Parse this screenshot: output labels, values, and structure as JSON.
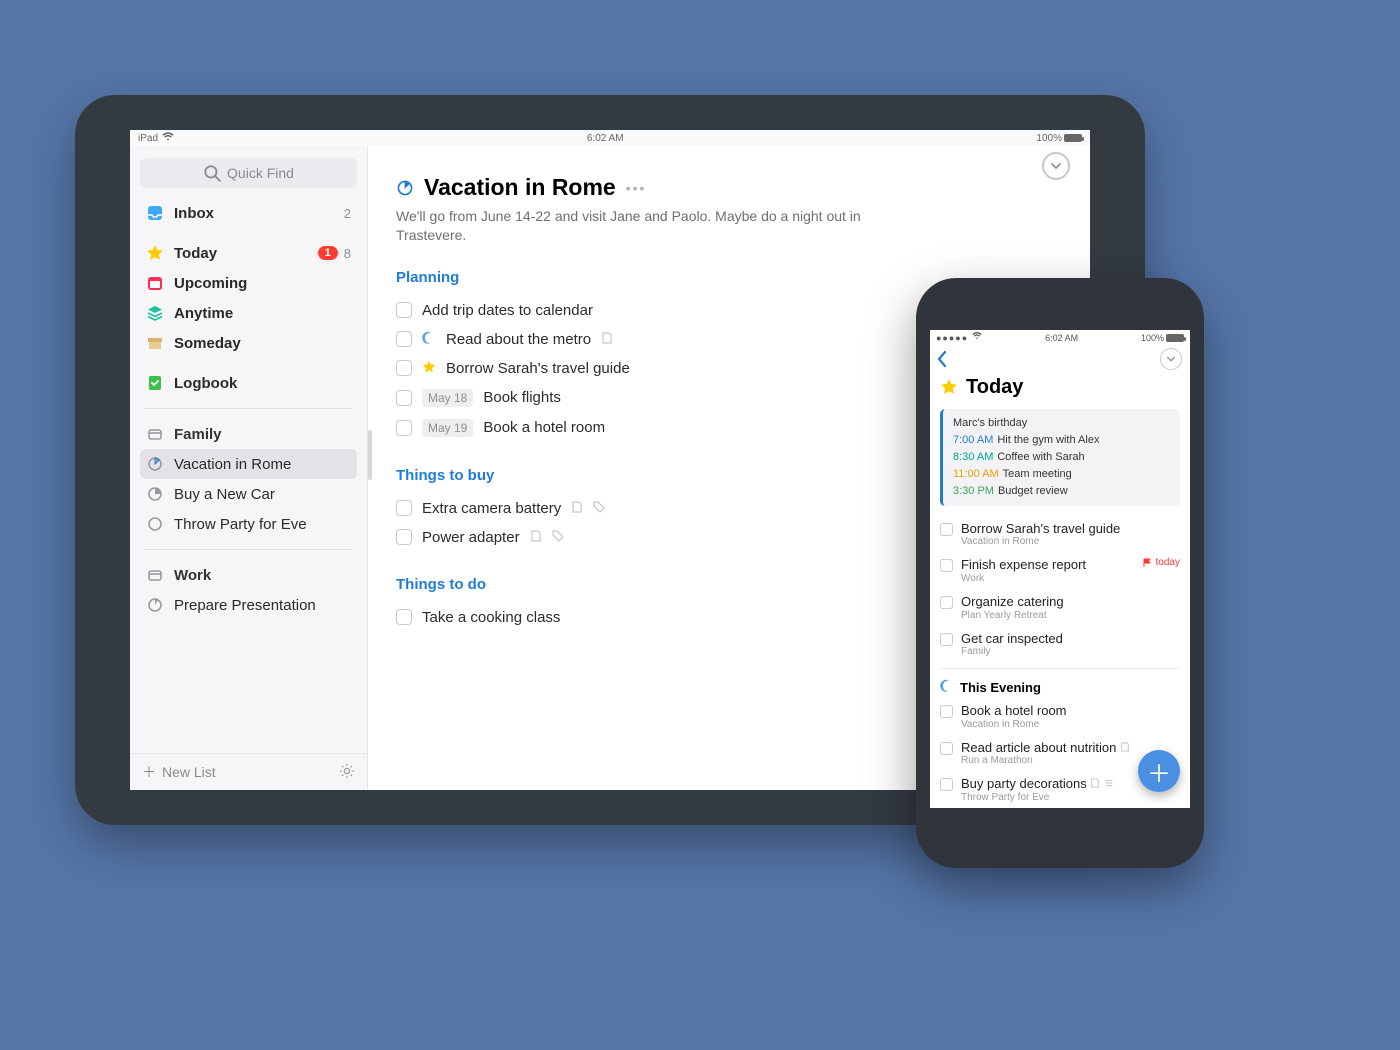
{
  "ipad": {
    "status": {
      "device": "iPad",
      "time": "6:02 AM",
      "battery": "100%"
    },
    "sidebar": {
      "quickfind_placeholder": "Quick Find",
      "inbox": {
        "label": "Inbox",
        "count": "2"
      },
      "today": {
        "label": "Today",
        "badge": "1",
        "count": "8"
      },
      "upcoming": {
        "label": "Upcoming"
      },
      "anytime": {
        "label": "Anytime"
      },
      "someday": {
        "label": "Someday"
      },
      "logbook": {
        "label": "Logbook"
      },
      "area_family": {
        "label": "Family"
      },
      "proj_vacation": {
        "label": "Vacation in Rome"
      },
      "proj_car": {
        "label": "Buy a New Car"
      },
      "proj_party": {
        "label": "Throw Party for Eve"
      },
      "area_work": {
        "label": "Work"
      },
      "proj_presentation": {
        "label": "Prepare Presentation"
      },
      "new_list": "New List"
    },
    "detail": {
      "title": "Vacation in Rome",
      "notes": "We'll go from June 14-22 and visit Jane and Paolo. Maybe do a night out in Trastevere.",
      "heading_planning": "Planning",
      "task_calendar": "Add trip dates to calendar",
      "task_metro": "Read about the metro",
      "task_borrow": "Borrow Sarah's travel guide",
      "task_flights_date": "May 18",
      "task_flights": "Book flights",
      "task_hotel_date": "May 19",
      "task_hotel": "Book a hotel room",
      "heading_buy": "Things to buy",
      "task_battery": "Extra camera battery",
      "task_adapter": "Power adapter",
      "heading_do": "Things to do",
      "task_cooking": "Take a cooking class"
    }
  },
  "phone": {
    "status": {
      "time": "6:02 AM",
      "battery": "100%"
    },
    "title": "Today",
    "calendar": {
      "allday": "Marc's birthday",
      "e1_time": "7:00 AM",
      "e1_text": "Hit the gym with Alex",
      "e2_time": "8:30 AM",
      "e2_text": "Coffee with Sarah",
      "e3_time": "11:00 AM",
      "e3_text": "Team meeting",
      "e4_time": "3:30 PM",
      "e4_text": "Budget review"
    },
    "tasks": {
      "t1": "Borrow Sarah's travel guide",
      "t1p": "Vacation in Rome",
      "t2": "Finish expense report",
      "t2p": "Work",
      "t2_flag": "today",
      "t3": "Organize catering",
      "t3p": "Plan Yearly Retreat",
      "t4": "Get car inspected",
      "t4p": "Family"
    },
    "evening_heading": "This Evening",
    "evening": {
      "e1": "Book a hotel room",
      "e1p": "Vacation in Rome",
      "e2": "Read article about nutrition",
      "e2p": "Run a Marathon",
      "e3": "Buy party decorations",
      "e3p": "Throw Party for Eve"
    }
  }
}
